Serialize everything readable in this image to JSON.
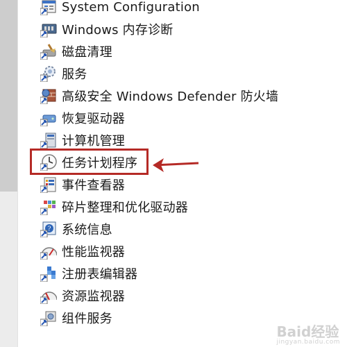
{
  "items": [
    {
      "label": "System Configuration",
      "icon": "system-configuration-icon"
    },
    {
      "label": "Windows 内存诊断",
      "icon": "memory-diagnostic-icon"
    },
    {
      "label": "磁盘清理",
      "icon": "disk-cleanup-icon"
    },
    {
      "label": "服务",
      "icon": "services-icon"
    },
    {
      "label": "高级安全 Windows Defender 防火墙",
      "icon": "firewall-icon"
    },
    {
      "label": "恢复驱动器",
      "icon": "recovery-drive-icon"
    },
    {
      "label": "计算机管理",
      "icon": "computer-management-icon"
    },
    {
      "label": "任务计划程序",
      "icon": "task-scheduler-icon"
    },
    {
      "label": "事件查看器",
      "icon": "event-viewer-icon"
    },
    {
      "label": "碎片整理和优化驱动器",
      "icon": "defragment-icon"
    },
    {
      "label": "系统信息",
      "icon": "system-information-icon"
    },
    {
      "label": "性能监视器",
      "icon": "performance-monitor-icon"
    },
    {
      "label": "注册表编辑器",
      "icon": "registry-editor-icon"
    },
    {
      "label": "资源监视器",
      "icon": "resource-monitor-icon"
    },
    {
      "label": "组件服务",
      "icon": "component-services-icon"
    }
  ],
  "highlighted_item": "任务计划程序",
  "highlight_color": "#b52a26",
  "watermark": {
    "text": "Baid经验",
    "sub": "jingyan.baidu.com"
  }
}
